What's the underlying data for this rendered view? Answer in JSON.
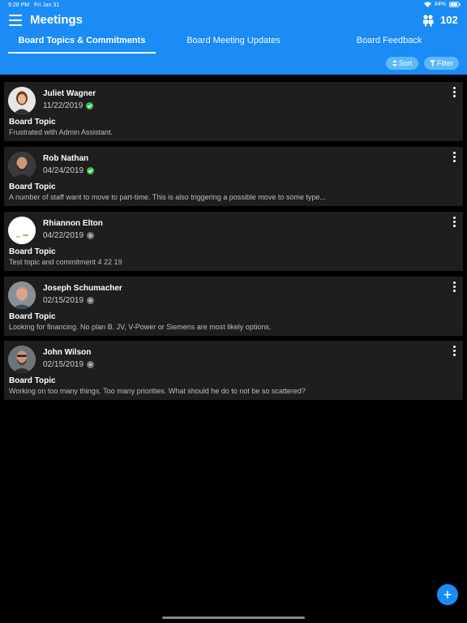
{
  "status_bar": {
    "time": "9:28 PM",
    "date": "Fri Jan 31",
    "battery": "84%"
  },
  "header": {
    "title": "Meetings",
    "count": "102"
  },
  "tabs": [
    {
      "label": "Board Topics & Commitments",
      "active": true
    },
    {
      "label": "Board Meeting Updates",
      "active": false
    },
    {
      "label": "Board Feedback",
      "active": false
    }
  ],
  "actions": {
    "sort_label": "Sort",
    "filter_label": "Filter"
  },
  "colors": {
    "brand": "#1b8cf5",
    "pill": "#5bb9f7",
    "card": "#1e1e1e",
    "complete": "#3fbf4a",
    "pending": "#777777"
  },
  "cards": [
    {
      "name": "Juliet Wagner",
      "date": "11/22/2019",
      "status": "complete",
      "topic_label": "Board Topic",
      "topic_text": "Frustrated with Admin Assistant."
    },
    {
      "name": "Rob Nathan",
      "date": "04/24/2019",
      "status": "complete",
      "topic_label": "Board Topic",
      "topic_text": "A number of staff want to move to part-time. This is also triggering a possible move to some type..."
    },
    {
      "name": "Rhiannon Elton",
      "date": "04/22/2019",
      "status": "pending",
      "topic_label": "Board Topic",
      "topic_text": "Test topic and commitment 4 22 19"
    },
    {
      "name": "Joseph Schumacher",
      "date": "02/15/2019",
      "status": "pending",
      "topic_label": "Board Topic",
      "topic_text": "Looking for financing. No plan B. JV, V-Power or Siemens are most likely options."
    },
    {
      "name": "John Wilson",
      "date": "02/15/2019",
      "status": "pending",
      "topic_label": "Board Topic",
      "topic_text": "Working on too many things. Too many priorities. What should he do to not be so scattered?"
    }
  ]
}
